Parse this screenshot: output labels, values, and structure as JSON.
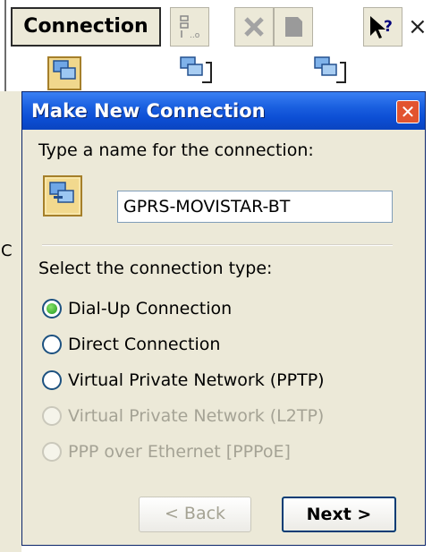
{
  "background": {
    "menu_label": "Connection",
    "toolbar_icons": [
      "properties-icon",
      "delete-icon",
      "view-icon",
      "help-icon"
    ],
    "close_label": "×",
    "clipped_letter": "C"
  },
  "dialog": {
    "title": "Make New Connection",
    "close_label": "✕",
    "name_prompt": "Type a name for the connection:",
    "name_value": "GPRS-MOVISTAR-BT",
    "type_prompt": "Select the connection type:",
    "options": [
      {
        "label": "Dial-Up Connection",
        "checked": true,
        "enabled": true
      },
      {
        "label": "Direct Connection",
        "checked": false,
        "enabled": true
      },
      {
        "label": "Virtual Private Network (PPTP)",
        "checked": false,
        "enabled": true
      },
      {
        "label": "Virtual Private Network (L2TP)",
        "checked": false,
        "enabled": false
      },
      {
        "label": "PPP over Ethernet [PPPoE]",
        "checked": false,
        "enabled": false
      }
    ],
    "back_label": "< Back",
    "next_label": "Next >"
  },
  "colors": {
    "title_bar": "#0c4ed4",
    "dialog_face": "#ece9d8",
    "close_button": "#e2542f",
    "radio_selected": "#1f9a1f"
  }
}
